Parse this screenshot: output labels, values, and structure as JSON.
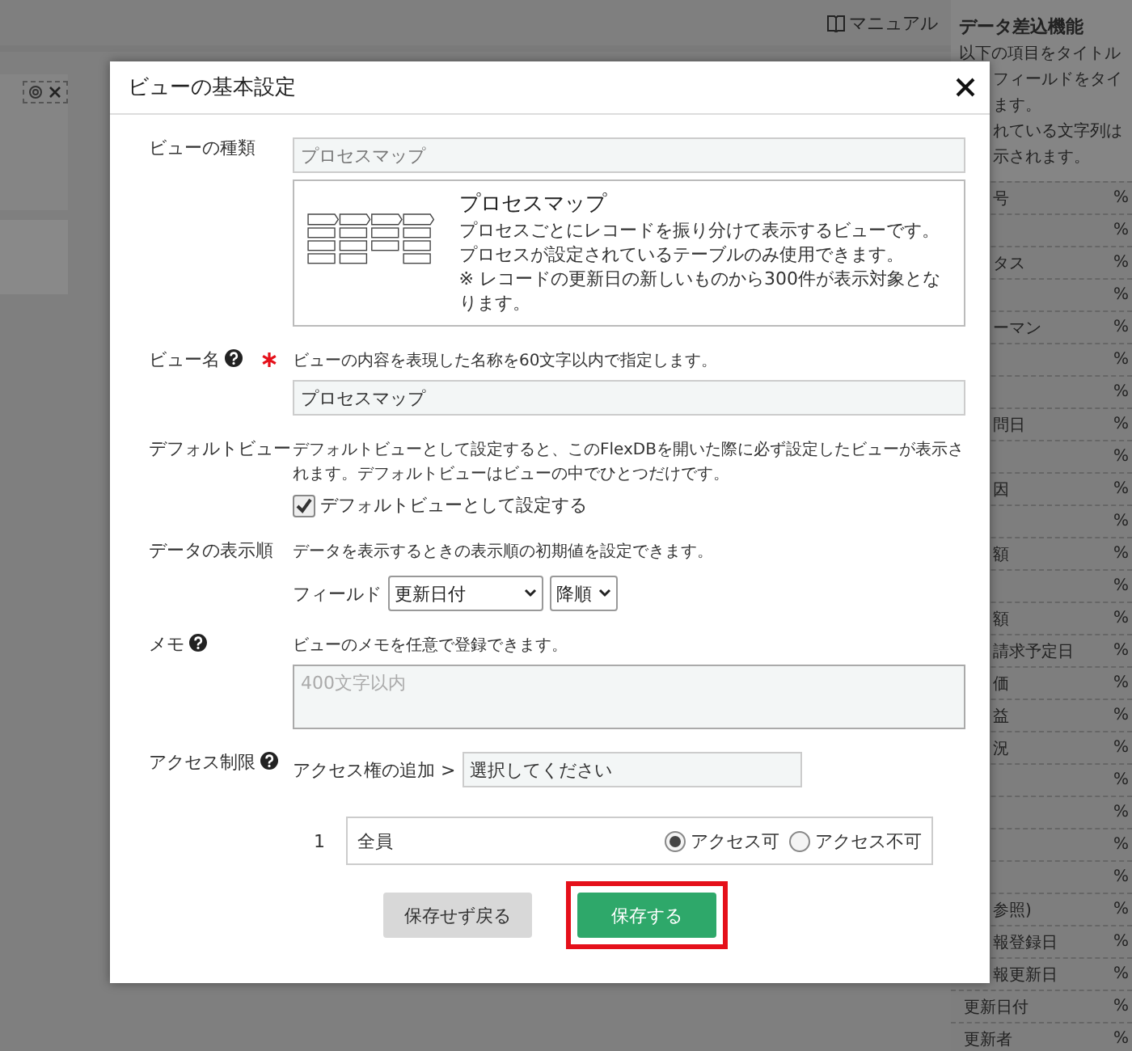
{
  "page": {
    "manual_link": "マニュアル"
  },
  "side_panel": {
    "title": "データ差込機能",
    "lines": [
      "以下の項目をタイトル",
      "フィールドをタイ",
      "ます。",
      "れている文字列は",
      "示されます。"
    ],
    "rows": [
      {
        "label": "号",
        "code": "%"
      },
      {
        "label": "",
        "code": "%"
      },
      {
        "label": "タス",
        "code": "%"
      },
      {
        "label": "",
        "code": "%"
      },
      {
        "label": "ーマン",
        "code": "%"
      },
      {
        "label": "",
        "code": "%"
      },
      {
        "label": "",
        "code": "%"
      },
      {
        "label": "問日",
        "code": "%"
      },
      {
        "label": "",
        "code": "%"
      },
      {
        "label": "因",
        "code": "%"
      },
      {
        "label": "",
        "code": "%"
      },
      {
        "label": "額",
        "code": "%"
      },
      {
        "label": "",
        "code": "%"
      },
      {
        "label": "額",
        "code": "%"
      },
      {
        "label": "請求予定日",
        "code": "%"
      },
      {
        "label": "価",
        "code": "%"
      },
      {
        "label": "益",
        "code": "%"
      },
      {
        "label": "況",
        "code": "%"
      },
      {
        "label": "",
        "code": "%"
      },
      {
        "label": "",
        "code": "%"
      },
      {
        "label": "",
        "code": "%"
      },
      {
        "label": "",
        "code": "%"
      },
      {
        "label": "参照)",
        "code": "%"
      },
      {
        "label": "報登録日",
        "code": "%"
      },
      {
        "label": "報更新日",
        "code": "%"
      },
      {
        "label": "更新日付",
        "code": "%"
      },
      {
        "label": "更新者",
        "code": "%"
      }
    ]
  },
  "dialog": {
    "title": "ビューの基本設定",
    "view_type": {
      "label": "ビューの種類",
      "value": "プロセスマップ",
      "card": {
        "title": "プロセスマップ",
        "paragraphs": [
          "プロセスごとにレコードを振り分けて表示するビューです。プロセスが設定されているテーブルのみ使用できます。",
          "※ レコードの更新日の新しいものから300件が表示対象となります。"
        ]
      }
    },
    "view_name": {
      "label": "ビュー名",
      "help": true,
      "required": true,
      "hint": "ビューの内容を表現した名称を60文字以内で指定します。",
      "value": "プロセスマップ"
    },
    "default_view": {
      "label": "デフォルトビュー",
      "hint": "デフォルトビューとして設定すると、このFlexDBを開いた際に必ず設定したビューが表示されます。デフォルトビューはビューの中でひとつだけです。",
      "checkbox": {
        "label": "デフォルトビューとして設定する",
        "checked": true
      }
    },
    "sort": {
      "label": "データの表示順",
      "hint": "データを表示するときの表示順の初期値を設定できます。",
      "field_label": "フィールド",
      "field_value": "更新日付",
      "order_value": "降順"
    },
    "memo": {
      "label": "メモ",
      "help": true,
      "hint": "ビューのメモを任意で登録できます。",
      "placeholder": "400文字以内"
    },
    "access": {
      "label": "アクセス制限",
      "help": true,
      "add_label": "アクセス権の追加 >",
      "select_value": "選択してください",
      "entries": [
        {
          "index": "1",
          "name": "全員",
          "options": [
            {
              "label": "アクセス可",
              "selected": true
            },
            {
              "label": "アクセス不可",
              "selected": false
            }
          ]
        }
      ]
    },
    "buttons": [
      {
        "label": "保存せず戻る",
        "kind": "secondary",
        "highlighted": false
      },
      {
        "label": "保存する",
        "kind": "primary",
        "highlighted": true
      }
    ]
  }
}
